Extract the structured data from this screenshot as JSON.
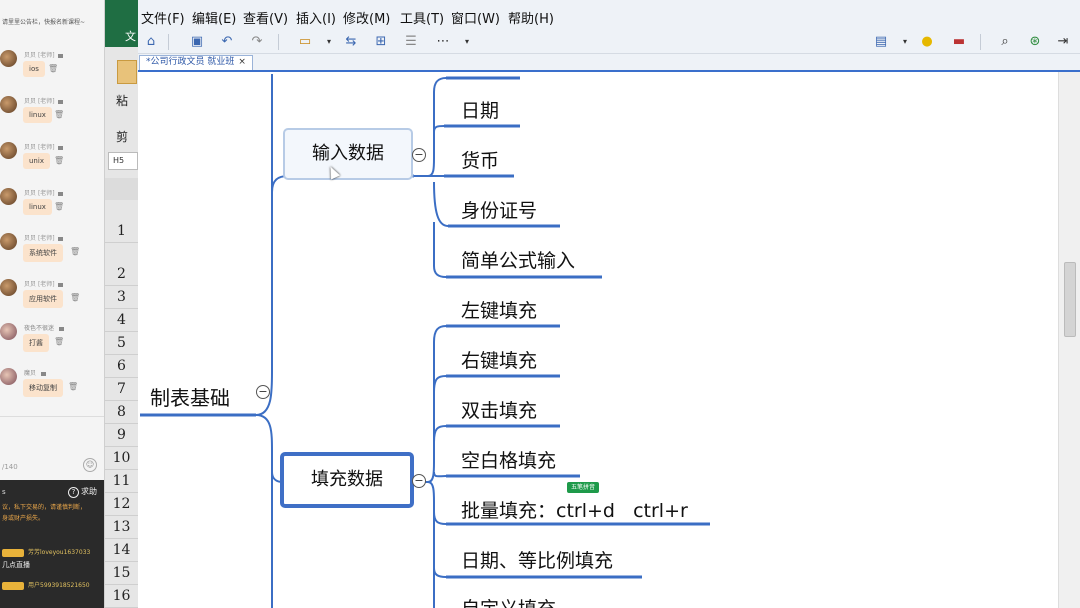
{
  "chat": {
    "header_text": "请里里公告栏，快报名新课程~",
    "messages": [
      {
        "name": "贝贝",
        "role": "[老师]",
        "text": "ios"
      },
      {
        "name": "贝贝",
        "role": "[老师]",
        "text": "linux"
      },
      {
        "name": "贝贝",
        "role": "[老师]",
        "text": "unix"
      },
      {
        "name": "贝贝",
        "role": "[老师]",
        "text": "linux"
      },
      {
        "name": "贝贝",
        "role": "[老师]",
        "text": "系统软件"
      },
      {
        "name": "贝贝",
        "role": "[老师]",
        "text": "应用软件"
      },
      {
        "name": "夜色不很迷",
        "role": "",
        "text": "打酱"
      },
      {
        "name": "魔贝",
        "role": "",
        "text": "移动复制"
      }
    ],
    "counter": "/140",
    "help_label": "求助",
    "notice_lines": [
      "议，私下交易的，请谨慎判断，",
      "身或财产损失。"
    ],
    "users": [
      {
        "name": "芳芳loveyou1637033"
      },
      {
        "name": "用户5993918521650"
      }
    ],
    "live_text": "几点直播"
  },
  "excel": {
    "ribbon_letter": "文",
    "paste_label": "粘",
    "clip_label": "剪",
    "namebox": "H5",
    "rows": [
      "1",
      "2",
      "3",
      "4",
      "5",
      "6",
      "7",
      "8",
      "9",
      "10",
      "11",
      "12",
      "13",
      "14",
      "15",
      "16"
    ]
  },
  "app": {
    "menu": [
      "文件(F)",
      "编辑(E)",
      "查看(V)",
      "插入(I)",
      "修改(M)",
      "工具(T)",
      "窗口(W)",
      "帮助(H)"
    ],
    "tab_title": "*公司行政文员 就业班",
    "tab_close": "×"
  },
  "mindmap": {
    "root": "制表基础",
    "branches": [
      {
        "label": "输入数据",
        "children": [
          "日期",
          "货币",
          "身份证号",
          "简单公式输入"
        ]
      },
      {
        "label": "填充数据",
        "children": [
          "左键填充",
          "右键填充",
          "双击填充",
          "空白格填充",
          "批量填充：ctrl+d   ctrl+r",
          "日期、等比例填充",
          "自定义填充"
        ]
      }
    ],
    "collapse_symbol": "−",
    "ime_badge": "五笔拼音"
  }
}
